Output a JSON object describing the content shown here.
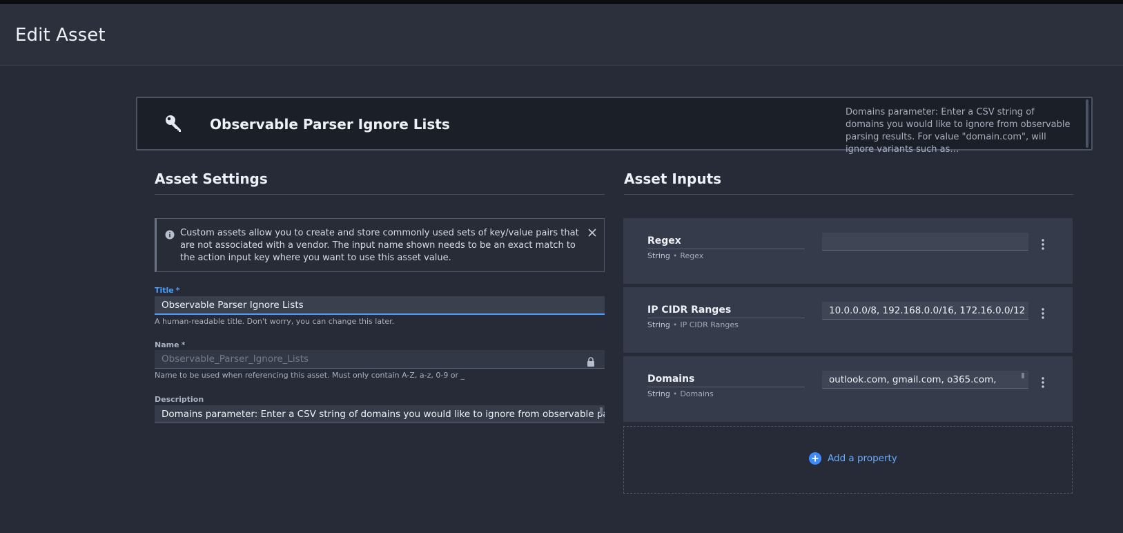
{
  "header": {
    "title": "Edit Asset"
  },
  "banner": {
    "icon": "key-icon",
    "title": "Observable Parser Ignore Lists",
    "description": "Domains parameter: Enter a CSV string of domains you would like to ignore from observable parsing results. For value \"domain.com\", will ignore variants such as…"
  },
  "settings": {
    "heading": "Asset Settings",
    "info": {
      "icon": "info-icon",
      "text": "Custom assets allow you to create and store commonly used sets of key/value pairs that are not associated with a vendor. The input name shown needs to be an exact match to the action input key where you want to use this asset value."
    },
    "title_field": {
      "label": "Title",
      "required": "*",
      "value": "Observable Parser Ignore Lists",
      "help": "A human-readable title. Don't worry, you can change this later."
    },
    "name_field": {
      "label": "Name",
      "required": "*",
      "value": "Observable_Parser_Ignore_Lists",
      "help": "Name to be used when referencing this asset. Must only contain A-Z, a-z, 0-9 or _"
    },
    "description_field": {
      "label": "Description",
      "value": "Domains parameter: Enter a CSV string of domains you would like to ignore from observable parsing"
    }
  },
  "inputs": {
    "heading": "Asset Inputs",
    "properties": [
      {
        "name": "Regex",
        "type": "String",
        "subtype": "Regex",
        "value": ""
      },
      {
        "name": "IP CIDR Ranges",
        "type": "String",
        "subtype": "IP CIDR Ranges",
        "value": "10.0.0.0/8, 192.168.0.0/16, 172.16.0.0/12"
      },
      {
        "name": "Domains",
        "type": "String",
        "subtype": "Domains",
        "value": "outlook.com, gmail.com, o365.com,"
      }
    ],
    "add_label": "Add a property"
  },
  "colors": {
    "background": "#262b37",
    "accent": "#4a9eff",
    "card": "#353b4a"
  }
}
